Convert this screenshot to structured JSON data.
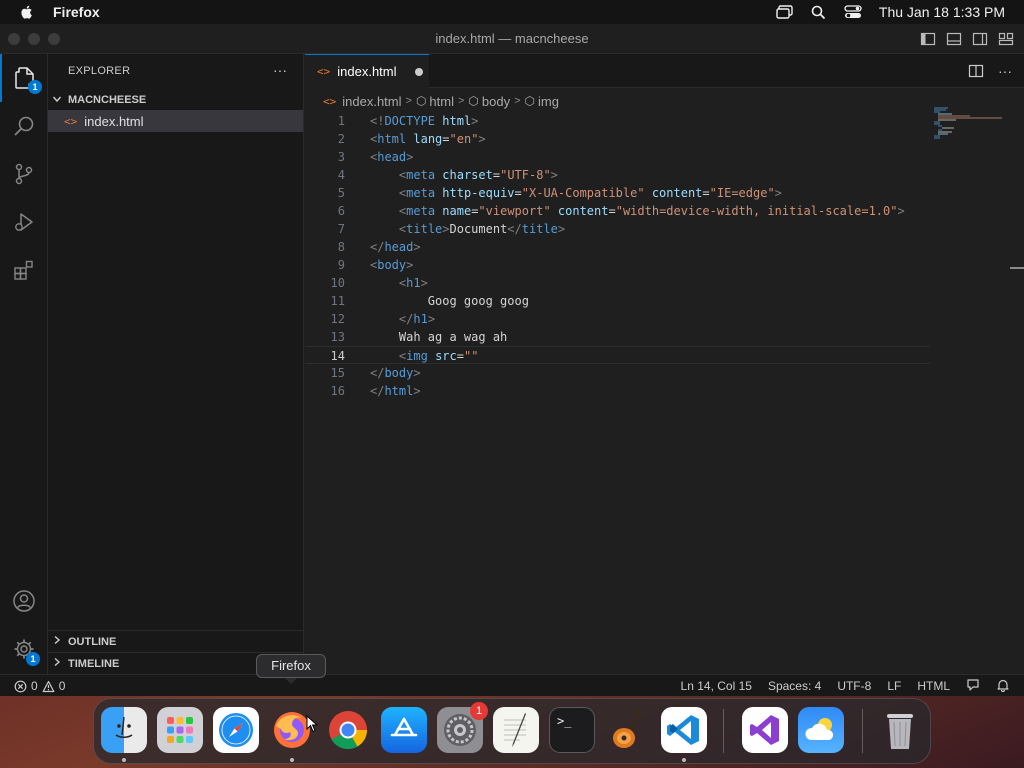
{
  "menubar": {
    "app_name": "Firefox",
    "clock": "Thu Jan 18  1:33 PM"
  },
  "window": {
    "title": "index.html — macncheese"
  },
  "activity": {
    "explorer_badge": "1",
    "settings_badge": "1"
  },
  "sidebar": {
    "title": "EXPLORER",
    "more": "···",
    "folder": "MACNCHEESE",
    "file": "index.html",
    "file_icon": "<>",
    "outline": "OUTLINE",
    "timeline": "TIMELINE"
  },
  "tab": {
    "icon": "<>",
    "label": "index.html"
  },
  "breadcrumb": {
    "file": "index.html",
    "items": [
      "html",
      "body",
      "img"
    ]
  },
  "code": {
    "line_numbers": [
      "1",
      "2",
      "3",
      "4",
      "5",
      "6",
      "7",
      "8",
      "9",
      "10",
      "11",
      "12",
      "13",
      "14",
      "15",
      "16"
    ],
    "current_line": "14"
  },
  "status": {
    "errors": "0",
    "warnings": "0",
    "position": "Ln 14, Col 15",
    "spaces": "Spaces: 4",
    "encoding": "UTF-8",
    "eol": "LF",
    "language": "HTML"
  },
  "tooltip": "Firefox",
  "dock": {
    "items": [
      "finder-icon",
      "launchpad-icon",
      "safari-icon",
      "firefox-icon",
      "chrome-icon",
      "app-store-icon",
      "system-settings-icon",
      "textedit-icon",
      "terminal-icon",
      "garageband-icon",
      "vscode-icon",
      "visual-studio-icon",
      "weather-icon",
      "trash-icon"
    ],
    "settings_badge": "1",
    "terminal_prompt": ">_"
  },
  "colors": {
    "accent": "#0078d4",
    "tag": "#569cd6",
    "attr": "#9cdcfe",
    "string": "#ce9178",
    "file_icon": "#e37933"
  }
}
